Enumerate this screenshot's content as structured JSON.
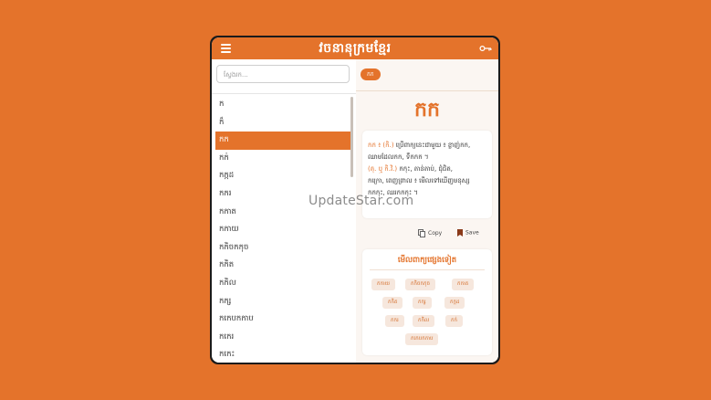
{
  "app": {
    "title": "វចនានុក្រមខ្មែរ",
    "menu_icon": "hamburger-menu-icon",
    "key_icon": "key-icon",
    "accent_color": "#E4732B"
  },
  "search": {
    "placeholder": "ស្វែងរក..."
  },
  "word_list": {
    "items": [
      {
        "label": "ក"
      },
      {
        "label": "ក៏"
      },
      {
        "label": "កក"
      },
      {
        "label": "កក់"
      },
      {
        "label": "កក្កដ"
      },
      {
        "label": "កករ"
      },
      {
        "label": "កកាត"
      },
      {
        "label": "កកាយ"
      },
      {
        "label": "កកិចកកុច"
      },
      {
        "label": "កកិត"
      },
      {
        "label": "កកិល"
      },
      {
        "label": "កក្ស"
      },
      {
        "label": "កកេបកកាប"
      },
      {
        "label": "កកេរ"
      },
      {
        "label": "កកេះ"
      }
    ],
    "selected_index": 2
  },
  "detail": {
    "chip": "កក",
    "headword": "កក",
    "definition": {
      "line1_accent": "កក ៖ (កិ.)",
      "line1_text": " ប្រើពាក្យនេះជាមួយ ៖ ខ្លាញ់កក,",
      "line2_text": "ឈាមដែលកក, ទឹកកក ។",
      "line2_accent": "(គុ. ឬ កិ.វិ.)",
      "line3_text": " កកុះ, តាន់តាប់, ជុំជិត,",
      "line4_text": "កក្រោ, ពេញព្រាល ៖ មើលទៅឃើញមនុស្ស",
      "line5_text": "កកកុះ, ឈរកកកុះ ។"
    },
    "copy_label": "Copy",
    "save_label": "Save",
    "copy_icon": "copy-icon",
    "save_icon": "bookmark-icon",
    "related_title": "មើលពាក្យផ្សេងទៀត",
    "related_tags": [
      {
        "label": "កកាយ"
      },
      {
        "label": "កកិចកកុច"
      },
      {
        "label": "កកាត"
      },
      {
        "label": "កកិត"
      },
      {
        "label": "កក្ស"
      },
      {
        "label": "កក្កដ"
      },
      {
        "label": "កករ"
      },
      {
        "label": "កកិល"
      },
      {
        "label": "កក់"
      },
      {
        "label": "កកេបកកាប"
      }
    ]
  },
  "watermark": "UpdateStar.com"
}
